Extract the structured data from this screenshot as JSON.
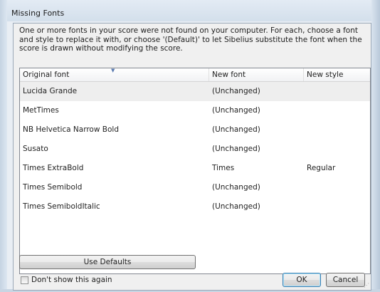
{
  "window": {
    "title": "Missing Fonts"
  },
  "description": "One or more fonts in your score were not found on your computer. For each, choose a font and style to replace it with, or choose '(Default)' to let Sibelius substitute the font when the score is drawn without modifying the score.",
  "table": {
    "columns": [
      "Original font",
      "New font",
      "New style"
    ],
    "rows": [
      {
        "original": "Lucida Grande",
        "new_font": "(Unchanged)",
        "new_style": "",
        "selected": true
      },
      {
        "original": "MetTimes",
        "new_font": "(Unchanged)",
        "new_style": ""
      },
      {
        "original": "NB Helvetica Narrow Bold",
        "new_font": "(Unchanged)",
        "new_style": ""
      },
      {
        "original": "Susato",
        "new_font": "(Unchanged)",
        "new_style": ""
      },
      {
        "original": "Times ExtraBold",
        "new_font": "Times",
        "new_style": "Regular"
      },
      {
        "original": "Times Semibold",
        "new_font": "(Unchanged)",
        "new_style": ""
      },
      {
        "original": "Times SemiboldItalic",
        "new_font": "(Unchanged)",
        "new_style": ""
      }
    ]
  },
  "buttons": {
    "use_defaults": "Use Defaults",
    "ok": "OK",
    "cancel": "Cancel"
  },
  "checkbox": {
    "label": "Don't show this again",
    "checked": false
  },
  "icons": {
    "sort": "sort-arrow-icon",
    "grip": "resize-grip-icon"
  }
}
